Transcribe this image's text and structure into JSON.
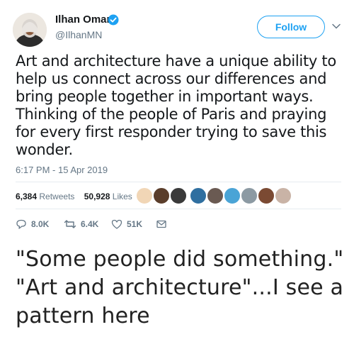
{
  "tweet": {
    "author_name": "Ilhan Omar",
    "handle": "@IlhanMN",
    "follow_label": "Follow",
    "text_lines": [
      "Art and architecture have a unique ability to",
      "help us connect across our differences and",
      "bring people together in important ways.",
      "Thinking of the people of Paris and praying",
      "for every first responder trying to save this",
      "wonder."
    ],
    "timestamp": "6:17 PM - 15 Apr 2019",
    "retweets_count": "6,384",
    "retweets_label": "Retweets",
    "likes_count": "50,928",
    "likes_label": "Likes",
    "actions": {
      "reply_count": "8.0K",
      "retweet_count": "6.4K",
      "like_count": "51K"
    },
    "accent_color": "#1da1f2"
  },
  "caption": {
    "lines": [
      "\"Some people did something.\"",
      "\"Art and architecture\"...I see a",
      "pattern here"
    ]
  }
}
